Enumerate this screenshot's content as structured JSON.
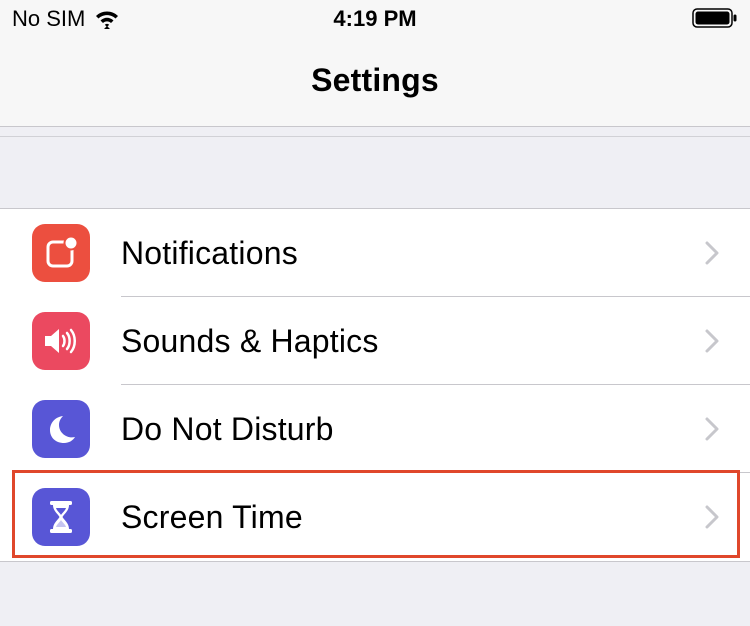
{
  "status_bar": {
    "carrier": "No SIM",
    "time": "4:19 PM",
    "icons": [
      "wifi-icon",
      "battery-icon"
    ]
  },
  "nav": {
    "title": "Settings"
  },
  "settings_rows": [
    {
      "label": "Notifications",
      "icon": "notifications-icon",
      "color": "#ec4f3f"
    },
    {
      "label": "Sounds & Haptics",
      "icon": "speaker-icon",
      "color": "#eb4960"
    },
    {
      "label": "Do Not Disturb",
      "icon": "moon-icon",
      "color": "#5856d6"
    },
    {
      "label": "Screen Time",
      "icon": "hourglass-icon",
      "color": "#5856d6"
    }
  ],
  "highlight": {
    "target": "Screen Time",
    "color": "#e0472b"
  },
  "colors": {
    "background": "#efeff4",
    "separator": "#c8c7cc",
    "chevron": "#c7c7cc"
  }
}
